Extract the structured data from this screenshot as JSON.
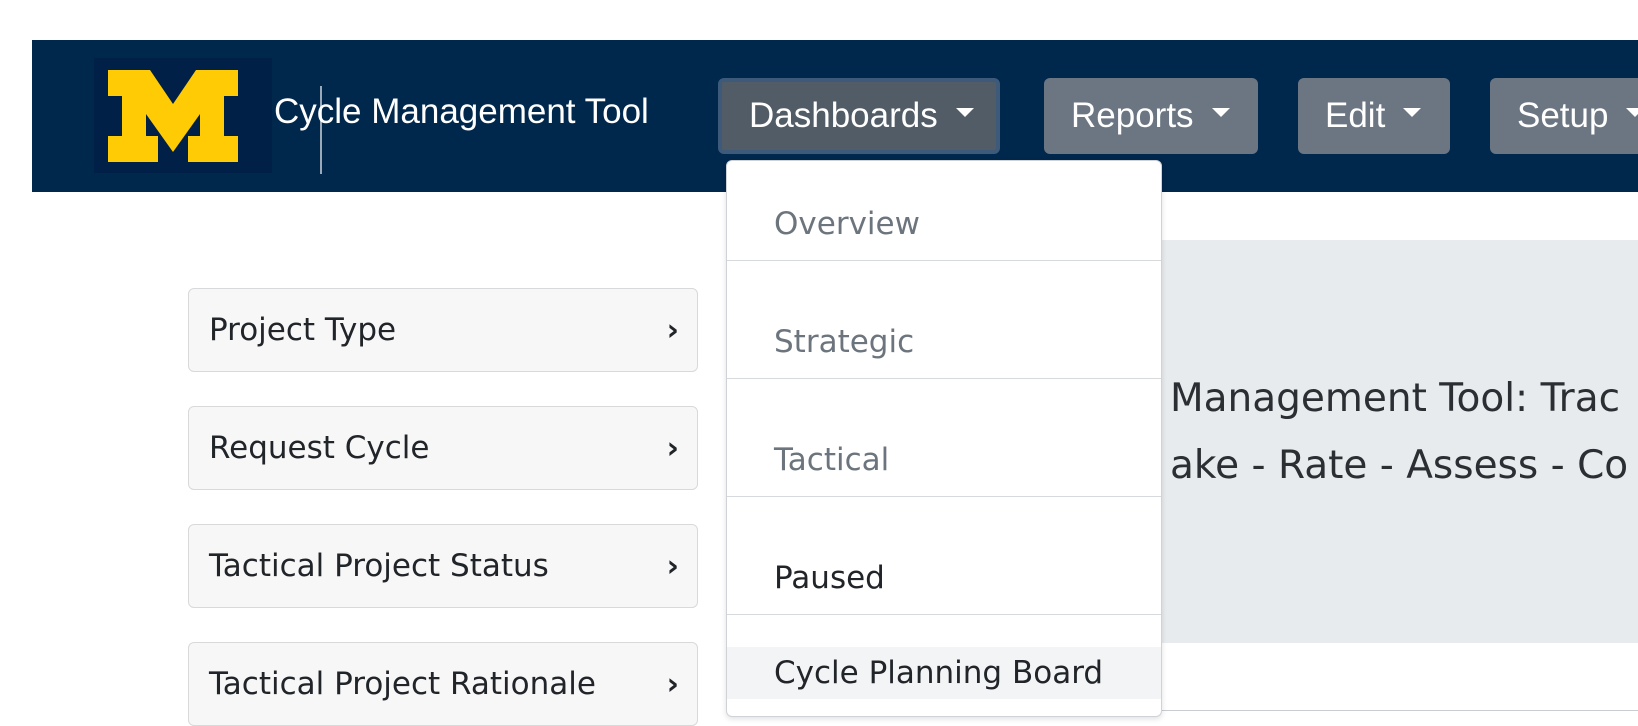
{
  "header": {
    "brand_title": "Cycle Management Tool",
    "logo_icon": "block-m-logo-icon",
    "colors": {
      "navbar": "#00274c",
      "logo_maize": "#ffcb05",
      "button": "#6b7682"
    },
    "nav": [
      {
        "label": "Dashboards",
        "active": true
      },
      {
        "label": "Reports"
      },
      {
        "label": "Edit"
      },
      {
        "label": "Setup"
      }
    ]
  },
  "dashboards_menu": {
    "items": [
      {
        "label": "Overview"
      },
      {
        "label": "Strategic"
      },
      {
        "label": "Tactical"
      },
      {
        "label": "Paused"
      },
      {
        "label": "Cycle Planning Board"
      }
    ]
  },
  "sidebar": {
    "items": [
      {
        "label": "Project Type",
        "chevron": "›"
      },
      {
        "label": "Request Cycle",
        "chevron": "›"
      },
      {
        "label": "Tactical Project Status",
        "chevron": "›"
      },
      {
        "label": "Tactical Project Rationale",
        "chevron": "›"
      }
    ]
  },
  "main": {
    "heading_line1": "Management Tool: Trac",
    "heading_line2": "ake - Rate - Assess - Co"
  }
}
